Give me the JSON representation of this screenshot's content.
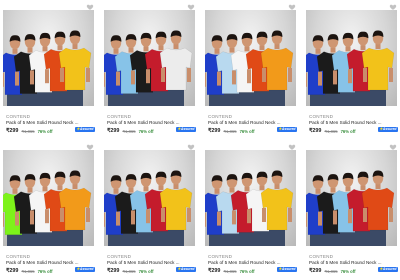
{
  "icons": {
    "wishlist": "heart-icon",
    "assured": "flipkart-assured-badge"
  },
  "assured_label": "Assured",
  "products": [
    {
      "brand": "CONTEND",
      "title": "Pack of 5 Men Solid Round Neck ...",
      "price": "₹299",
      "mrp": "₹1,865",
      "discount": "76% off",
      "shirt_colors": [
        "#1f3ec9",
        "#1b1b1b",
        "#f5f5f5",
        "#e04a16",
        "#f2c21a"
      ]
    },
    {
      "brand": "CONTEND",
      "title": "Pack of 5 Men Solid Round Neck ...",
      "price": "₹299",
      "mrp": "₹1,865",
      "discount": "76% off",
      "shirt_colors": [
        "#1f3ec9",
        "#87c3e8",
        "#1b1b1b",
        "#c41c2c",
        "#ececec"
      ]
    },
    {
      "brand": "CONTEND",
      "title": "Pack of 5 Men Solid Round Neck ...",
      "price": "₹299",
      "mrp": "₹1,865",
      "discount": "76% off",
      "shirt_colors": [
        "#1f3ec9",
        "#b8d9ef",
        "#f5f5f5",
        "#e04a16",
        "#f29a1a"
      ]
    },
    {
      "brand": "CONTEND",
      "title": "Pack of 5 Men Solid Round Neck ...",
      "price": "₹299",
      "mrp": "₹1,865",
      "discount": "76% off",
      "shirt_colors": [
        "#1f3ec9",
        "#1b1b1b",
        "#87c3e8",
        "#c41c2c",
        "#f2c21a"
      ]
    },
    {
      "brand": "CONTEND",
      "title": "Pack of 5 Men Solid Round Neck ...",
      "price": "₹299",
      "mrp": "₹1,865",
      "discount": "76% off",
      "shirt_colors": [
        "#7df21a",
        "#1b1b1b",
        "#f5f5f5",
        "#e04a16",
        "#f29a1a"
      ]
    },
    {
      "brand": "CONTEND",
      "title": "Pack of 5 Men Solid Round Neck ...",
      "price": "₹299",
      "mrp": "₹1,865",
      "discount": "76% off",
      "shirt_colors": [
        "#1f3ec9",
        "#1b1b1b",
        "#87c3e8",
        "#c41c2c",
        "#f2c21a"
      ]
    },
    {
      "brand": "CONTEND",
      "title": "Pack of 5 Men Solid Round Neck ...",
      "price": "₹299",
      "mrp": "₹1,865",
      "discount": "76% off",
      "shirt_colors": [
        "#1f3ec9",
        "#b8d9ef",
        "#c41c2c",
        "#f5f5f5",
        "#f2c21a"
      ]
    },
    {
      "brand": "CONTEND",
      "title": "Pack of 5 Men Solid Round Neck ...",
      "price": "₹299",
      "mrp": "₹1,865",
      "discount": "76% off",
      "shirt_colors": [
        "#1f3ec9",
        "#1b1b1b",
        "#87c3e8",
        "#c41c2c",
        "#e04a16"
      ]
    }
  ]
}
